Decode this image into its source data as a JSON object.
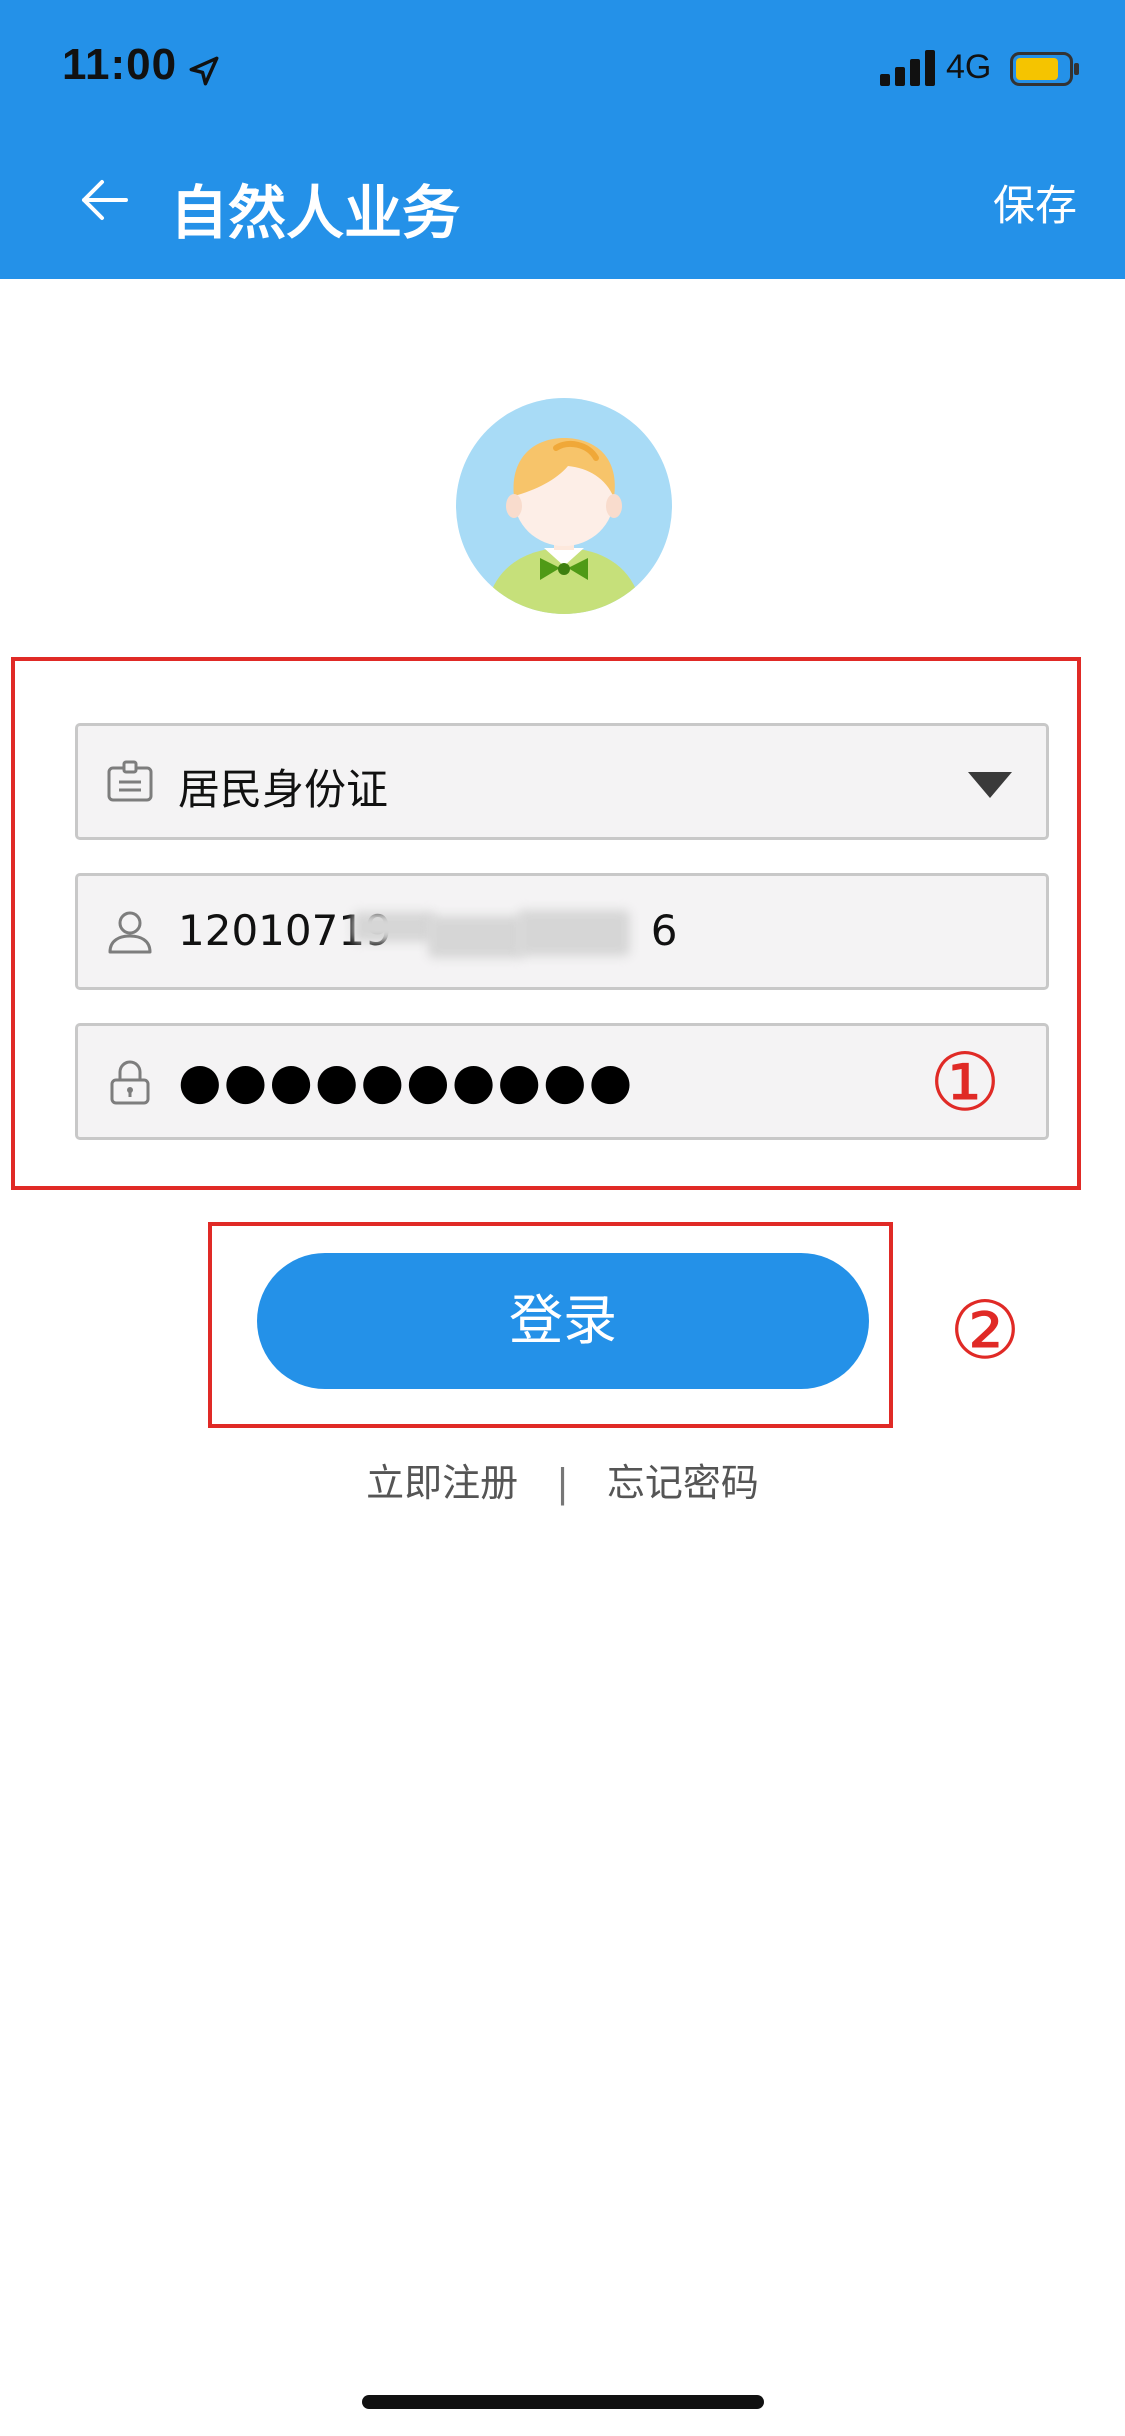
{
  "status_bar": {
    "time": "11:00",
    "network": "4G",
    "location_icon": "location-arrow-icon",
    "signal_icon": "signal-bars-icon",
    "battery_icon": "battery-icon",
    "battery_color": "#f5c400"
  },
  "header": {
    "title": "自然人业务",
    "action_label": "保存",
    "back_icon": "back-arrow-icon",
    "background": "#2491e8"
  },
  "form": {
    "id_type": {
      "value": "居民身份证",
      "icon": "id-card-icon",
      "caret_icon": "dropdown-caret-icon"
    },
    "id_number": {
      "value_visible_start": "12010719",
      "value_visible_end": "6",
      "icon": "user-icon"
    },
    "password": {
      "masked_value": "●●●●●●●●●●",
      "icon": "lock-icon"
    }
  },
  "login_button": {
    "label": "登录",
    "color": "#2491e8"
  },
  "links": {
    "register": "立即注册",
    "separator": "|",
    "forgot": "忘记密码"
  },
  "annotations": {
    "marker_1": "①",
    "marker_2": "②",
    "color": "#e02a26"
  }
}
